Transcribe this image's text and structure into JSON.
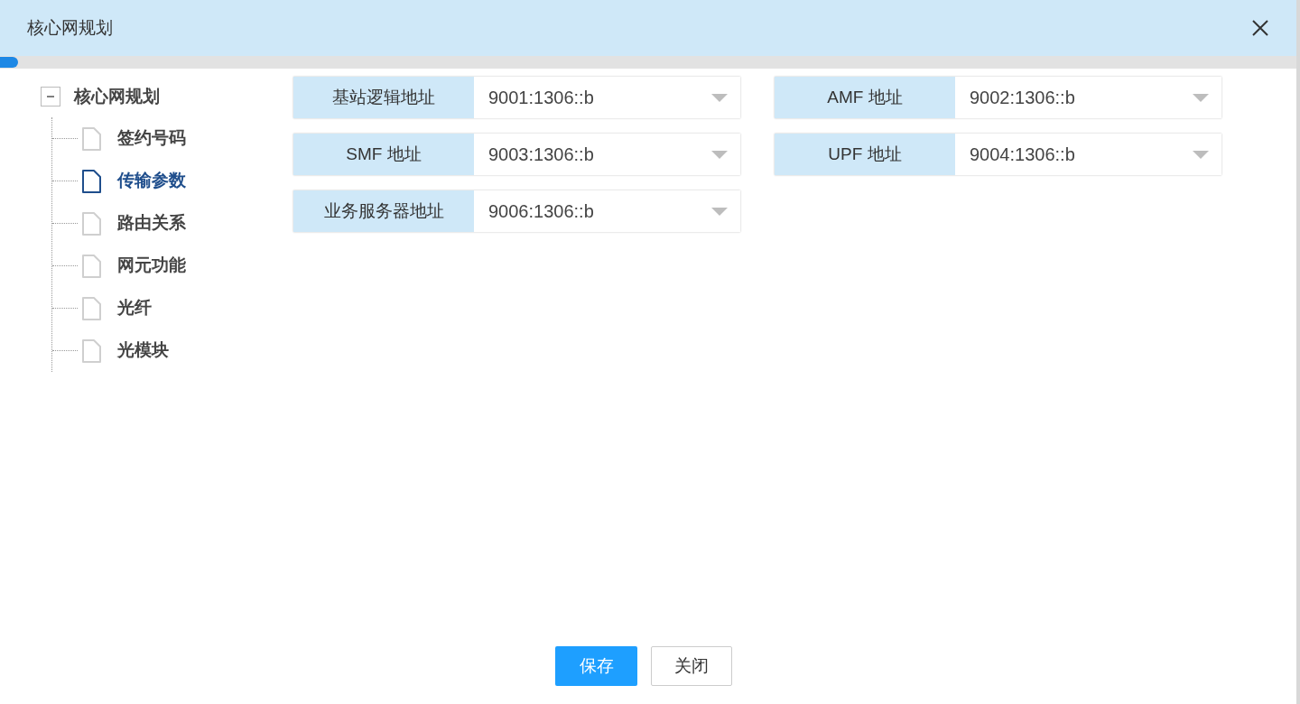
{
  "dialog": {
    "title": "核心网规划"
  },
  "tree": {
    "label": "核心网规划",
    "expanded": true,
    "children": [
      {
        "label": "签约号码",
        "selected": false
      },
      {
        "label": "传输参数",
        "selected": true
      },
      {
        "label": "路由关系",
        "selected": false
      },
      {
        "label": "网元功能",
        "selected": false
      },
      {
        "label": "光纤",
        "selected": false
      },
      {
        "label": "光模块",
        "selected": false
      }
    ]
  },
  "fields": [
    {
      "label": "基站逻辑地址",
      "value": "9001:1306::b"
    },
    {
      "label": "AMF 地址",
      "value": "9002:1306::b"
    },
    {
      "label": "SMF 地址",
      "value": "9003:1306::b"
    },
    {
      "label": "UPF 地址",
      "value": "9004:1306::b"
    },
    {
      "label": "业务服务器地址",
      "value": "9006:1306::b"
    }
  ],
  "buttons": [
    {
      "label": "保存",
      "kind": "primary"
    },
    {
      "label": "关闭",
      "kind": "default"
    }
  ]
}
